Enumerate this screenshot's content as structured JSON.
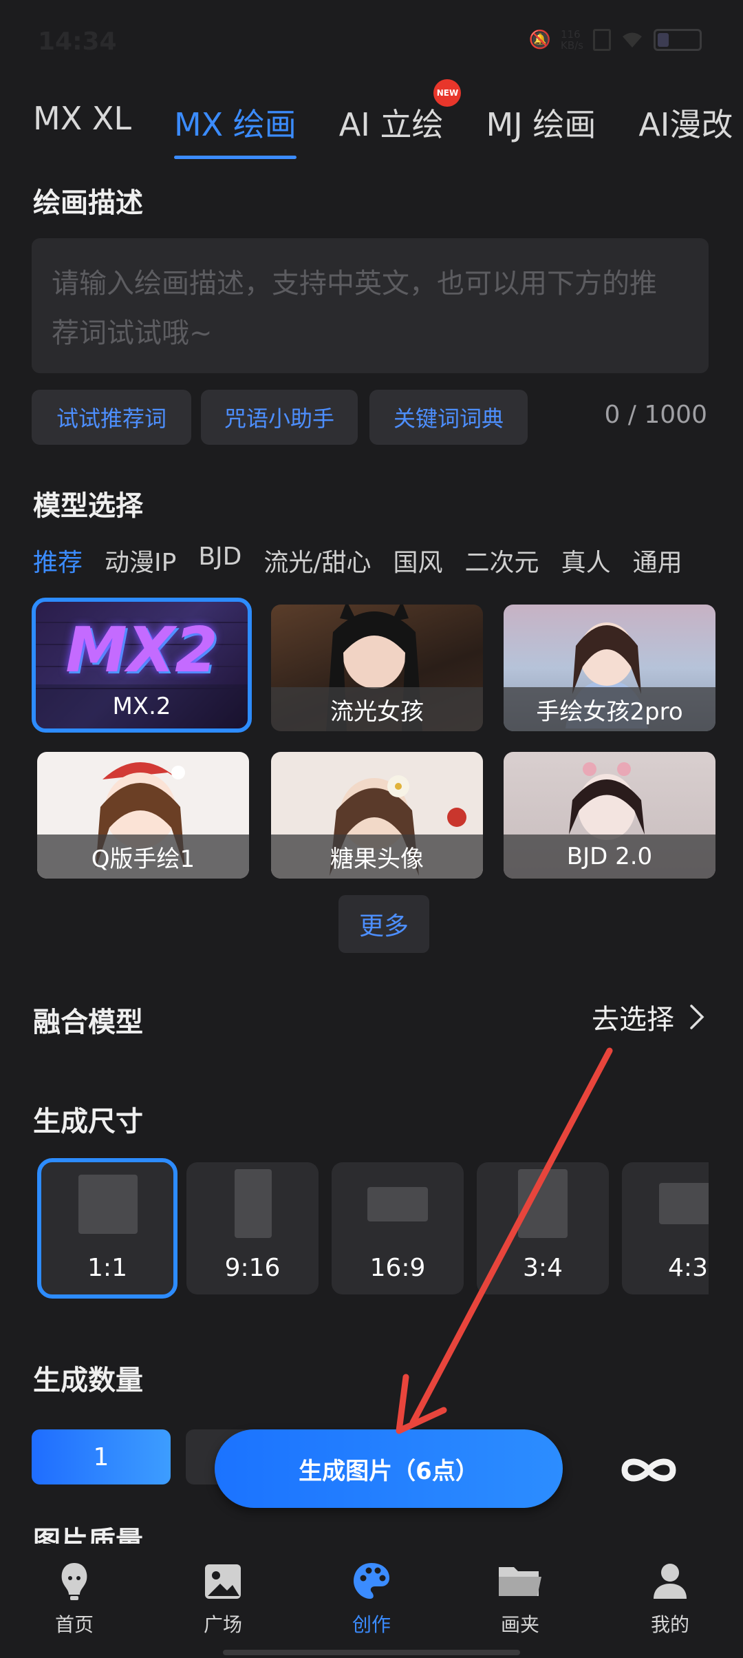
{
  "status": {
    "time": "14:34",
    "net_speed_value": "116",
    "net_speed_unit": "KB/s",
    "battery_level": 0.25
  },
  "tabs": [
    {
      "label": "MX XL",
      "active": false
    },
    {
      "label": "MX 绘画",
      "active": true
    },
    {
      "label": "AI 立绘",
      "active": false,
      "badge": "NEW"
    },
    {
      "label": "MJ 绘画",
      "active": false
    },
    {
      "label": "AI漫改",
      "active": false
    }
  ],
  "description": {
    "title": "绘画描述",
    "placeholder": "请输入绘画描述，支持中英文，也可以用下方的推荐词试试哦~",
    "chips": [
      "试试推荐词",
      "咒语小助手",
      "关键词词典"
    ],
    "counter": "0 / 1000"
  },
  "models": {
    "title": "模型选择",
    "categories": [
      "推荐",
      "动漫IP",
      "BJD",
      "流光/甜心",
      "国风",
      "二次元",
      "真人",
      "通用"
    ],
    "active_category": "推荐",
    "cards": [
      {
        "label": "MX.2",
        "logo_text": "MX2",
        "selected": true
      },
      {
        "label": "流光女孩",
        "selected": false
      },
      {
        "label": "手绘女孩2pro",
        "selected": false
      },
      {
        "label": "Q版手绘1",
        "selected": false
      },
      {
        "label": "糖果头像",
        "selected": false
      },
      {
        "label": "BJD 2.0",
        "selected": false
      }
    ],
    "more_label": "更多"
  },
  "fusion": {
    "title": "融合模型",
    "action": "去选择"
  },
  "size": {
    "title": "生成尺寸",
    "options": [
      {
        "label": "1:1",
        "selected": true
      },
      {
        "label": "9:16",
        "selected": false
      },
      {
        "label": "16:9",
        "selected": false
      },
      {
        "label": "3:4",
        "selected": false
      },
      {
        "label": "4:3",
        "selected": false
      }
    ]
  },
  "quantity": {
    "title": "生成数量",
    "selected": "1"
  },
  "generate_button": "生成图片（6点）",
  "quality_title": "图片质量",
  "nav": [
    {
      "label": "首页",
      "icon": "bulb-face-icon",
      "active": false
    },
    {
      "label": "广场",
      "icon": "image-icon",
      "active": false
    },
    {
      "label": "创作",
      "icon": "palette-icon",
      "active": true
    },
    {
      "label": "画夹",
      "icon": "folder-icon",
      "active": false
    },
    {
      "label": "我的",
      "icon": "user-icon",
      "active": false
    }
  ],
  "colors": {
    "accent": "#3b8cff",
    "background": "#1c1c1e",
    "annotation_arrow": "#e8453c"
  }
}
